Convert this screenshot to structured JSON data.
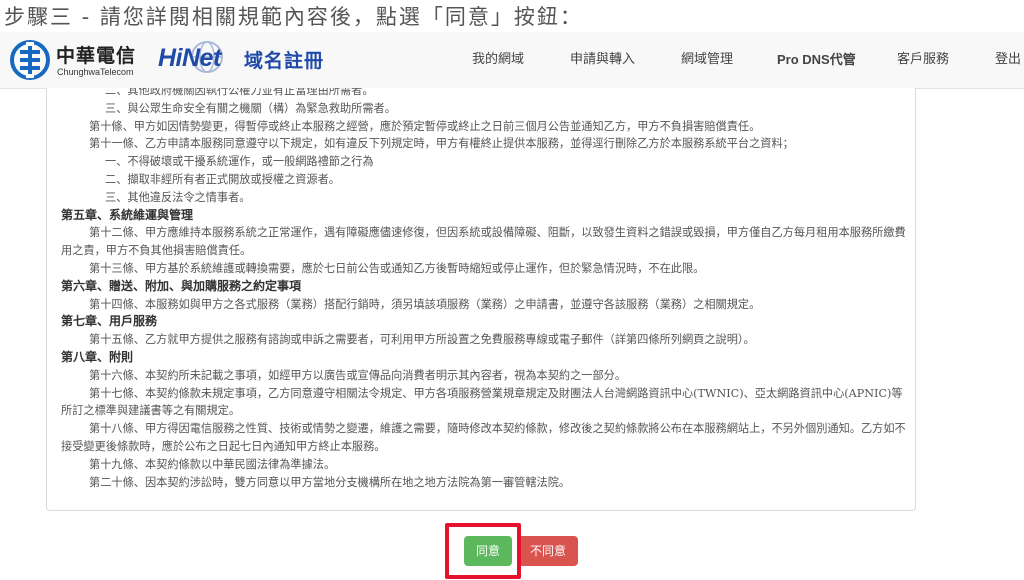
{
  "step_title": "步驟三 - 請您詳閱相關規範內容後，點選「同意」按鈕：",
  "brand": {
    "cht_name": "中華電信",
    "cht_en": "ChunghwaTelecom",
    "hinet": "HiNet",
    "service": "域名註冊"
  },
  "nav": {
    "items": [
      {
        "label": "我的網域"
      },
      {
        "label": "申請與轉入"
      },
      {
        "label": "網域管理"
      },
      {
        "label": "Pro DNS代管"
      },
      {
        "label": "客戶服務"
      },
      {
        "label": "登出"
      }
    ]
  },
  "terms": {
    "lines": [
      "二、其他政府機關因執行公權力並有正當理由所需者。",
      "三、與公眾生命安全有關之機關（構）為緊急救助所需者。",
      "第十條、甲方如因情勢變更，得暫停或終止本服務之經營，應於預定暫停或終止之日前三個月公告並通知乙方，甲方不負損害賠償責任。",
      "第十一條、乙方申請本服務同意遵守以下規定，如有違反下列規定時，甲方有權終止提供本服務，並得逕行刪除乙方於本服務系統平台之資料；",
      "一、不得破壞或干擾系統運作，或一般網路禮節之行為",
      "二、擷取非經所有者正式開放或授權之資源者。",
      "三、其他違反法令之情事者。",
      "第五章、系統維運與管理",
      "第十二條、甲方應維持本服務系統之正常運作，遇有障礙應儘速修復，但因系統或設備障礙、阻斷，以致發生資料之錯誤或毀損，甲方僅自乙方每月租用本服務所繳費用之責，甲方不負其他損害賠償責任。",
      "第十三條、甲方基於系統維護或轉換需要，應於七日前公告或通知乙方後暫時縮短或停止運作，但於緊急情況時，不在此限。",
      "第六章、贈送、附加、與加購服務之約定事項",
      "第十四條、本服務如與甲方之各式服務（業務）搭配行銷時，須另填該項服務（業務）之申請書，並遵守各該服務（業務）之相關規定。",
      "第七章、用戶服務",
      "第十五條、乙方就甲方提供之服務有諮詢或申訴之需要者，可利用甲方所設置之免費服務專線或電子郵件（詳第四條所列網頁之說明）。",
      "第八章、附則",
      "第十六條、本契約所未記載之事項，如經甲方以廣告或宣傳品向消費者明示其內容者，視為本契約之一部分。",
      "第十七條、本契約條款未規定事項，乙方同意遵守相關法令規定、甲方各項服務營業規章規定及財團法人台灣網路資訊中心(TWNIC)、亞太網路資訊中心(APNIC)等所訂之標準與建議書等之有關規定。",
      "第十八條、甲方得因電信服務之性質、技術或情勢之變遷，維護之需要，隨時修改本契約條款，修改後之契約條款將公布在本服務網站上，不另外個別通知。乙方如不接受變更後條款時，應於公布之日起七日內通知甲方終止本服務。",
      "第十九條、本契約條款以中華民國法律為準據法。",
      "第二十條、因本契約涉訟時，雙方同意以甲方當地分支機構所在地之地方法院為第一審管轄法院。"
    ]
  },
  "buttons": {
    "agree": "同意",
    "disagree": "不同意"
  },
  "colors": {
    "agree": "#5cb85c",
    "disagree": "#d9534f",
    "highlight": "#e8112d",
    "brand_blue": "#1f4aa8"
  }
}
